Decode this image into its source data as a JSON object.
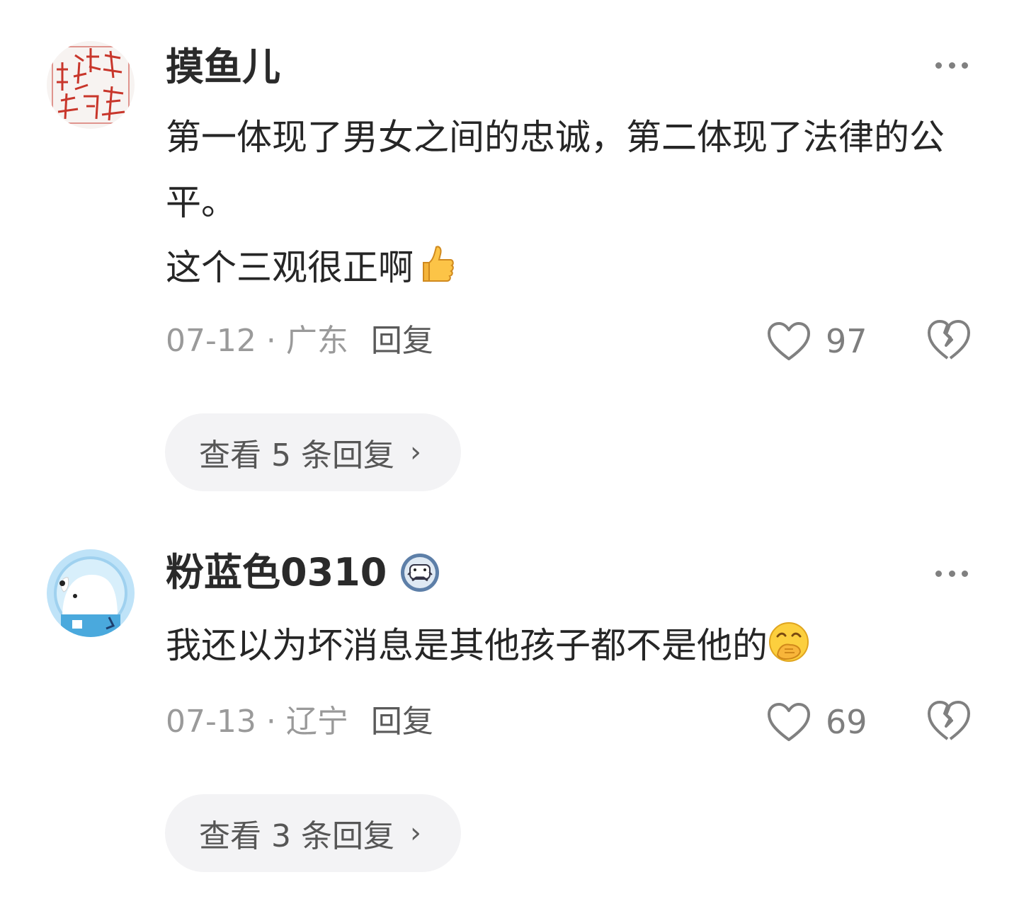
{
  "comments": [
    {
      "username": "摸鱼儿",
      "lines": [
        "第一体现了男女之间的忠诚，第二体现了法律的公平。",
        "这个三观很正啊"
      ],
      "emoji": "thumbs-up",
      "date": "07-12",
      "separator": "·",
      "location": "广东",
      "reply_label": "回复",
      "likes": "97",
      "view_replies": "查看 5 条回复",
      "avatar": "red-seal-stamp"
    },
    {
      "username": "粉蓝色0310",
      "lines": [
        "我还以为坏消息是其他孩子都不是他的"
      ],
      "emoji": "hand-over-mouth",
      "date": "07-13",
      "separator": "·",
      "location": "辽宁",
      "reply_label": "回复",
      "likes": "69",
      "view_replies": "查看 3 条回复",
      "avatar": "blue-puppy-astronaut"
    }
  ],
  "icons": {
    "more": "more-dots-icon",
    "like": "heart-outline-icon",
    "dislike": "broken-heart-icon",
    "chevron": "›"
  },
  "colors": {
    "meta_text": "#9a9a9a",
    "button_bg": "#f3f3f5",
    "seal_red": "#c8362b",
    "avatar_blue": "#a9d7f3"
  }
}
